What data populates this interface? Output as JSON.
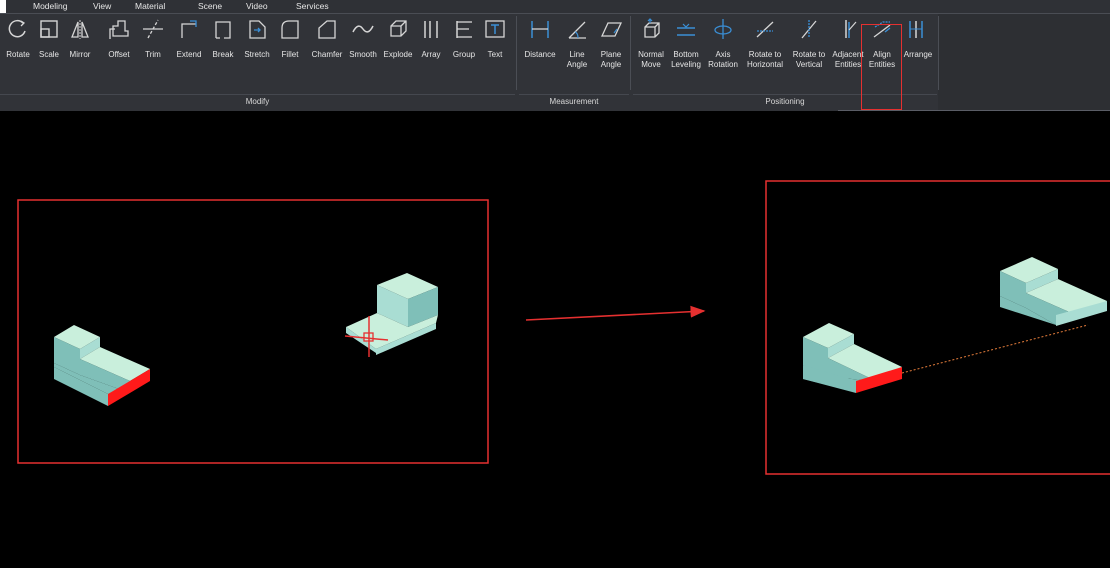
{
  "menubar": {
    "tabs": [
      {
        "label": "Modeling"
      },
      {
        "label": "View"
      },
      {
        "label": "Material"
      },
      {
        "label": "Scene"
      },
      {
        "label": "Video"
      },
      {
        "label": "Services"
      }
    ]
  },
  "ribbon": {
    "groups": {
      "modify": {
        "label": "Modify",
        "tools": [
          {
            "label": "Rotate",
            "icon": "rotate-icon"
          },
          {
            "label": "Scale",
            "icon": "scale-icon"
          },
          {
            "label": "Mirror",
            "icon": "mirror-icon"
          },
          {
            "label": "Offset",
            "icon": "offset-icon"
          },
          {
            "label": "Trim",
            "icon": "trim-icon"
          },
          {
            "label": "Extend",
            "icon": "extend-icon"
          },
          {
            "label": "Break",
            "icon": "break-icon"
          },
          {
            "label": "Stretch",
            "icon": "stretch-icon"
          },
          {
            "label": "Fillet",
            "icon": "fillet-icon"
          },
          {
            "label": "Chamfer",
            "icon": "chamfer-icon"
          },
          {
            "label": "Smooth",
            "icon": "smooth-icon"
          },
          {
            "label": "Explode",
            "icon": "explode-icon"
          },
          {
            "label": "Array",
            "icon": "array-icon"
          },
          {
            "label": "Group",
            "icon": "group-icon"
          },
          {
            "label": "Text",
            "icon": "text-icon"
          }
        ]
      },
      "measurement": {
        "label": "Measurement",
        "tools": [
          {
            "label": "Distance",
            "icon": "distance-icon"
          },
          {
            "label": "Line\nAngle",
            "icon": "line-angle-icon"
          },
          {
            "label": "Plane\nAngle",
            "icon": "plane-angle-icon"
          }
        ]
      },
      "positioning": {
        "label": "Positioning",
        "tools": [
          {
            "label": "Normal\nMove",
            "icon": "normal-move-icon"
          },
          {
            "label": "Bottom\nLeveling",
            "icon": "bottom-leveling-icon"
          },
          {
            "label": "Axis\nRotation",
            "icon": "axis-rotation-icon"
          },
          {
            "label": "Rotate to\nHorizontal",
            "icon": "rotate-horizontal-icon"
          },
          {
            "label": "Rotate to\nVertical",
            "icon": "rotate-vertical-icon"
          },
          {
            "label": "Adjacent\nEntities",
            "icon": "adjacent-entities-icon"
          },
          {
            "label": "Align\nEntities",
            "icon": "align-entities-icon"
          },
          {
            "label": "Arrange",
            "icon": "arrange-icon"
          }
        ]
      }
    }
  },
  "colors": {
    "ribbon_bg": "#313338",
    "icon_stroke": "#d6d6d6",
    "icon_accent": "#3a8fd6",
    "annotation_red": "#e53030",
    "block_top": "#c9efdc",
    "block_side": "#7fbfb8",
    "block_front": "#a9ddd3",
    "edge_highlight": "#ff1a1a"
  }
}
